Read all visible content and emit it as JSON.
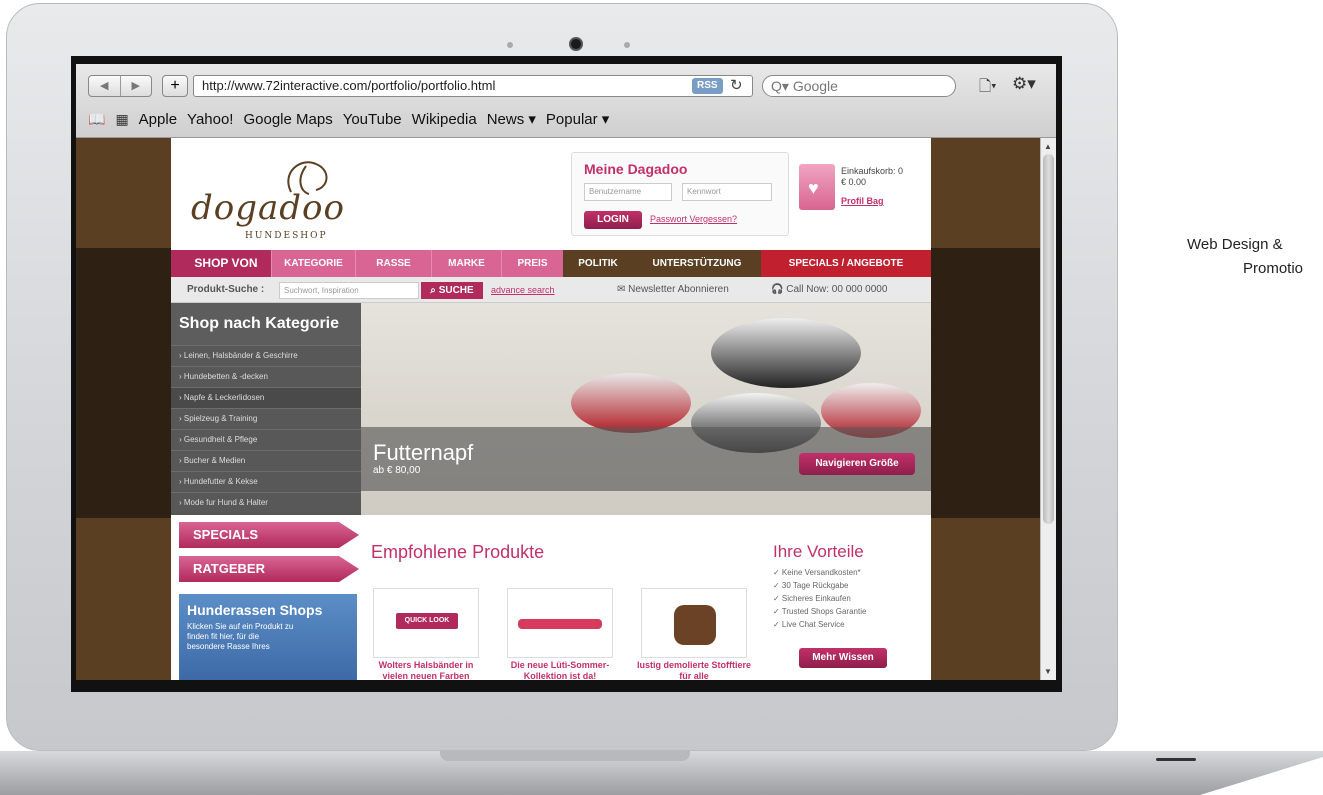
{
  "browser": {
    "url": "http://www.72interactive.com/portfolio/portfolio.html",
    "rss_label": "RSS",
    "search_placeholder": "Google",
    "bookmarks": [
      "Apple",
      "Yahoo!",
      "Google Maps",
      "YouTube",
      "Wikipedia",
      "News ▾",
      "Popular ▾"
    ]
  },
  "side_caption": {
    "line1": "Web Design &",
    "line2": "Promotio"
  },
  "site": {
    "logo": "dogadoo",
    "logo_sub": "HUNDESHOP",
    "login": {
      "title": "Meine Dagadoo",
      "username_placeholder": "Benutzername",
      "password_placeholder": "Kennwort",
      "button": "LOGIN",
      "forgot": "Passwort Vergessen?"
    },
    "cart": {
      "label": "Einkaufskorb: 0",
      "amount": "€ 0.00",
      "profil": "Profil Bag"
    },
    "nav": [
      "SHOP VON",
      "KATEGORIE",
      "RASSE",
      "MARKE",
      "PREIS",
      "POLITIK",
      "UNTERSTÜTZUNG",
      "SPECIALS / ANGEBOTE"
    ],
    "search": {
      "label": "Produkt-Suche :",
      "placeholder": "Suchwort, Inspiration",
      "button": "SUCHE",
      "advanced": "advance search",
      "newsletter": "Newsletter Abonnieren",
      "call": "Call Now: 00 000 0000"
    },
    "category": {
      "title": "Shop nach Kategorie",
      "items": [
        "› Leinen, Halsbänder & Geschirre",
        "› Hundebetten & -decken",
        "› Napfe & Leckerlidosen",
        "› Spielzeug & Training",
        "› Gesundheit & Pflege",
        "› Bucher & Medien",
        "› Hundefutter & Kekse",
        "› Mode fur Hund & Halter"
      ]
    },
    "hero": {
      "title": "Futternapf",
      "subtitle": "ab € 80,00",
      "button": "Navigieren Größe"
    },
    "left_tabs": [
      "SPECIALS",
      "RATGEBER"
    ],
    "rassen": {
      "title": "Hunderassen Shops",
      "text": "Klicken Sie auf ein Produkt zu finden fit hier, für die besondere Rasse Ihres"
    },
    "featured": {
      "title": "Empfohlene Produkte",
      "quicklook": "QUICK LOOK",
      "products": [
        "Wolters Halsbänder in vielen neuen Farben",
        "Die neue Lüti-Sommer-Kollektion ist da!",
        "lustig demolierte Stofftiere für alle"
      ]
    },
    "benefits": {
      "title": "Ihre Vorteile",
      "items": [
        "✓ Keine Versandkosten*",
        "✓ 30 Tage Rückgabe",
        "✓ Sicheres Einkaufen",
        "✓ Trusted Shops Garantie",
        "✓ Live Chat Service"
      ],
      "button": "Mehr Wissen"
    }
  }
}
